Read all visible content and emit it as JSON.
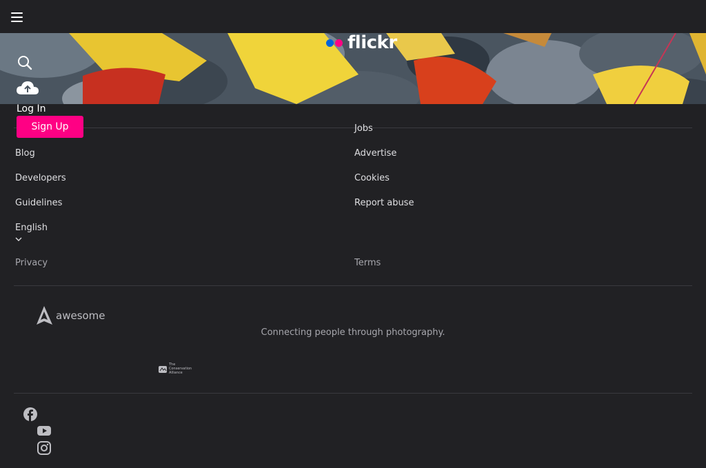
{
  "header": {
    "logo_text": "flickr",
    "menu_icon": "hamburger-menu-icon",
    "search_icon": "search-icon",
    "upload_icon": "upload-cloud-icon",
    "login_label": "Log In",
    "signup_label": "Sign Up"
  },
  "footer": {
    "left_links": [
      "Blog",
      "Developers",
      "Guidelines"
    ],
    "right_links": [
      "Jobs",
      "Advertise",
      "Cookies",
      "Report abuse"
    ],
    "language": "English",
    "privacy_label": "Privacy",
    "terms_label": "Terms",
    "awesome_logo_text": "awesome",
    "tagline": "Connecting people through photography.",
    "alliance_text_1": "The",
    "alliance_text_2": "Conservation",
    "alliance_text_3": "Alliance"
  },
  "social": [
    "facebook-icon",
    "youtube-icon",
    "instagram-icon"
  ],
  "colors": {
    "background": "#212124",
    "accent_pink": "#ff0084",
    "accent_blue": "#0063dc"
  }
}
